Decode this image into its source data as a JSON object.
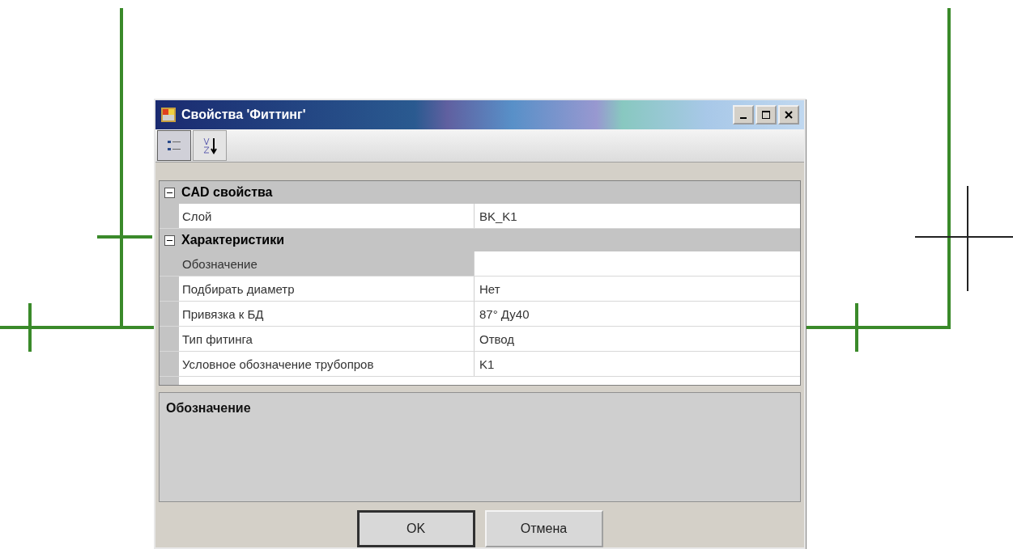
{
  "window": {
    "title": "Свойства 'Фиттинг'"
  },
  "toolbar": [
    {
      "kind": "categorized",
      "selected": true
    },
    {
      "kind": "alphabetical",
      "selected": false
    }
  ],
  "categories": [
    {
      "name": "CAD свойства",
      "expanded": true,
      "properties": [
        {
          "label": "Слой",
          "value": "BK_K1",
          "selected": false
        }
      ]
    },
    {
      "name": "Характеристики",
      "expanded": true,
      "properties": [
        {
          "label": "Обозначение",
          "selected": true
        },
        {
          "label": "Подбирать диаметр",
          "value": "Нет",
          "selected": false
        },
        {
          "label": "Привязка к БД",
          "value": "87° Ду40",
          "selected": false
        },
        {
          "label": "Тип фитинга",
          "value": "Отвод",
          "selected": false
        },
        {
          "label": "Условное обозначение трубопров",
          "value": "K1",
          "selected": false
        }
      ]
    }
  ],
  "description": {
    "title": "Обозначение"
  },
  "buttons": [
    {
      "label": "OK",
      "default": true
    },
    {
      "label": "Отмена",
      "default": false
    }
  ]
}
